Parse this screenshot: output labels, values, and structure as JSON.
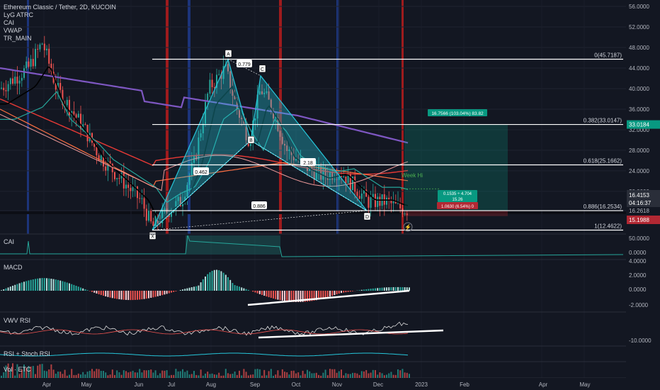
{
  "legend": {
    "title": "Ethereum Classic / Tether, 2D, KUCOIN",
    "indicators": [
      "LyG ATRC",
      "CAI",
      "VWAP",
      "TR_MAIN"
    ]
  },
  "panes": {
    "cai": "CAI",
    "macd": "MACD",
    "vwv": "VWV RSI",
    "rsi": "RSI + Stoch RSI",
    "vol": "Vol · ETC"
  },
  "price_axis": {
    "ticks": [
      "56.0000",
      "52.0000",
      "48.0000",
      "44.0000",
      "40.0000",
      "36.0000",
      "32.0000",
      "28.0000",
      "24.0000",
      "20.0000",
      "16.2618"
    ],
    "ticks_values": [
      56,
      52,
      48,
      44,
      40,
      36,
      32,
      28,
      24,
      20,
      16.2618
    ],
    "current_price": "16.4153",
    "countdown": "04:16:37",
    "target_badge": "33.0184",
    "stop_badge": "15.1988"
  },
  "pane_axes": {
    "cai": [
      "50.0000",
      "0.0000"
    ],
    "macd": [
      "4.0000",
      "2.0000",
      "0.0000",
      "-2.0000"
    ],
    "vwv": [
      "-10.0000"
    ]
  },
  "time_axis": [
    "Apr",
    "May",
    "Jun",
    "Jul",
    "Aug",
    "Sep",
    "Oct",
    "Nov",
    "Dec",
    "2023",
    "Feb",
    "Apr",
    "May"
  ],
  "fib_levels": [
    {
      "label": "0(45.7187)",
      "value": 45.7187
    },
    {
      "label": "0.382(33.0147)",
      "value": 33.0147
    },
    {
      "label": "0.618(25.1662)",
      "value": 25.1662
    },
    {
      "label": "0.886(16.2534)",
      "value": 16.2534
    },
    {
      "label": "1(12.4622)",
      "value": 12.4622
    }
  ],
  "pattern": {
    "points": [
      "X",
      "A",
      "B",
      "C",
      "D"
    ],
    "ratios": [
      "0.779",
      "0.462",
      "2.18",
      "0.886"
    ]
  },
  "position": {
    "target_text": "16.7566 (103.04%) 83.82",
    "entry_text": "0.1535 ÷ 4.704",
    "entry_sub": "15.26",
    "stop_text": "1.0630 (6.54%) 0"
  },
  "week_hi": "Week Hi",
  "colors": {
    "background": "#131722",
    "up": "#26a69a",
    "down": "#ef5350",
    "harmonic": "#26c6da",
    "vwap": "#7e57c2",
    "red_band": "#b71c1c",
    "blue_band": "#1e3a8a",
    "badge_green": "#089981",
    "badge_red": "#b22833"
  }
}
